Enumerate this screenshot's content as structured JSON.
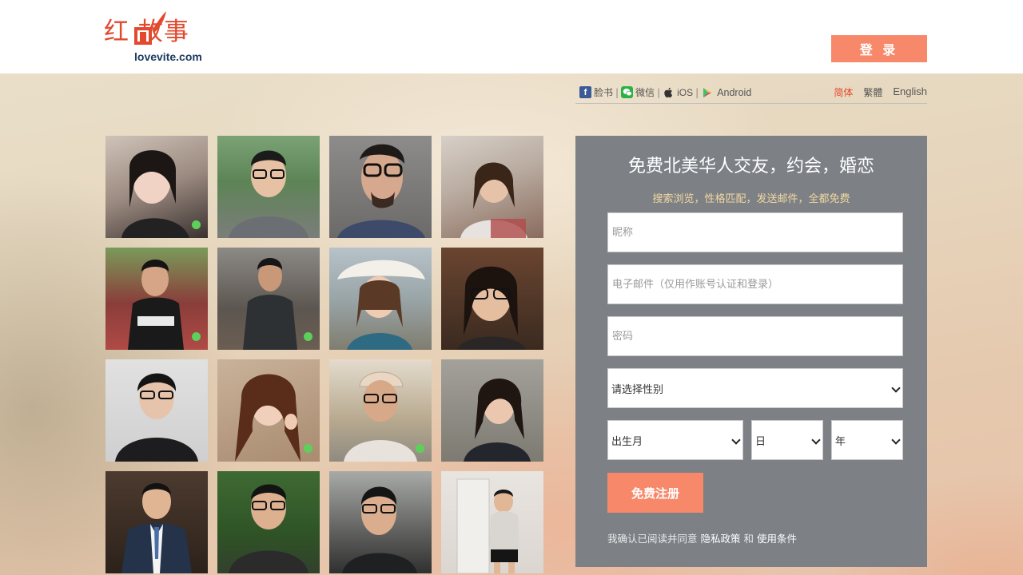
{
  "header": {
    "logo_cn": "红 故事",
    "logo_en": "lovevite.com",
    "login_label": "登 录"
  },
  "social": {
    "facebook": "脸书",
    "wechat": "微信",
    "ios": "iOS",
    "android": "Android",
    "separator": "|"
  },
  "languages": {
    "simplified": "简体",
    "traditional": "繁體",
    "english": "English"
  },
  "photos": [
    {
      "online": true
    },
    {
      "online": false
    },
    {
      "online": false
    },
    {
      "online": false
    },
    {
      "online": true
    },
    {
      "online": true
    },
    {
      "online": false
    },
    {
      "online": false
    },
    {
      "online": false
    },
    {
      "online": true
    },
    {
      "online": true
    },
    {
      "online": false
    },
    {
      "online": false
    },
    {
      "online": false
    },
    {
      "online": false
    },
    {
      "online": false
    }
  ],
  "signup": {
    "title": "免费北美华人交友，约会，婚恋",
    "subtitle": "搜索浏览，性格匹配，发送邮件，全都免费",
    "nickname_placeholder": "昵称",
    "email_placeholder": "电子邮件（仅用作账号认证和登录）",
    "password_placeholder": "密码",
    "gender_selected": "请选择性别",
    "month_selected": "出生月",
    "day_selected": "日",
    "year_selected": "年",
    "register_label": "免费注册",
    "terms_prefix": "我确认已阅读并同意",
    "privacy_label": "隐私政策",
    "and_label": "和",
    "terms_label": "使用条件"
  },
  "colors": {
    "brand_red": "#e2492f",
    "accent_orange": "#f7896a",
    "panel_gray": "#7d8186",
    "subtitle_gold": "#f2d79f",
    "online_green": "#5cd05a"
  }
}
